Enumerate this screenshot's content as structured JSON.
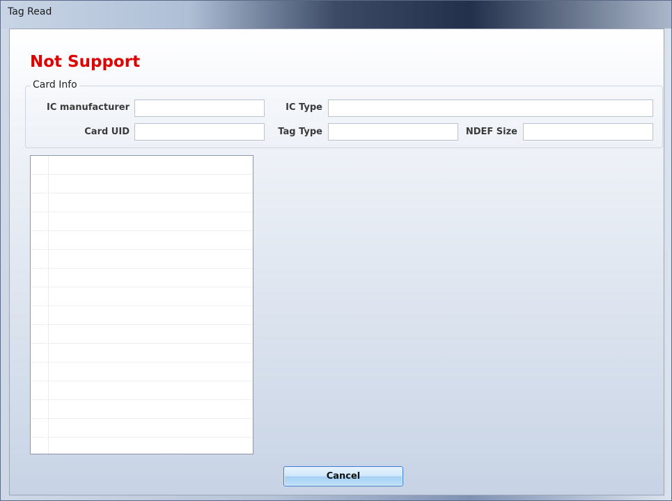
{
  "window": {
    "title": "Tag Read"
  },
  "status_text": "Not Support",
  "colors": {
    "status": "#e10000"
  },
  "card_info": {
    "legend": "Card Info",
    "ic_manufacturer": {
      "label": "IC manufacturer",
      "value": ""
    },
    "ic_type": {
      "label": "IC Type",
      "value": ""
    },
    "card_uid": {
      "label": "Card UID",
      "value": ""
    },
    "tag_type": {
      "label": "Tag Type",
      "value": ""
    },
    "ndef_size": {
      "label": "NDEF Size",
      "value": ""
    }
  },
  "data_list": {
    "rows": []
  },
  "buttons": {
    "cancel": "Cancel"
  }
}
